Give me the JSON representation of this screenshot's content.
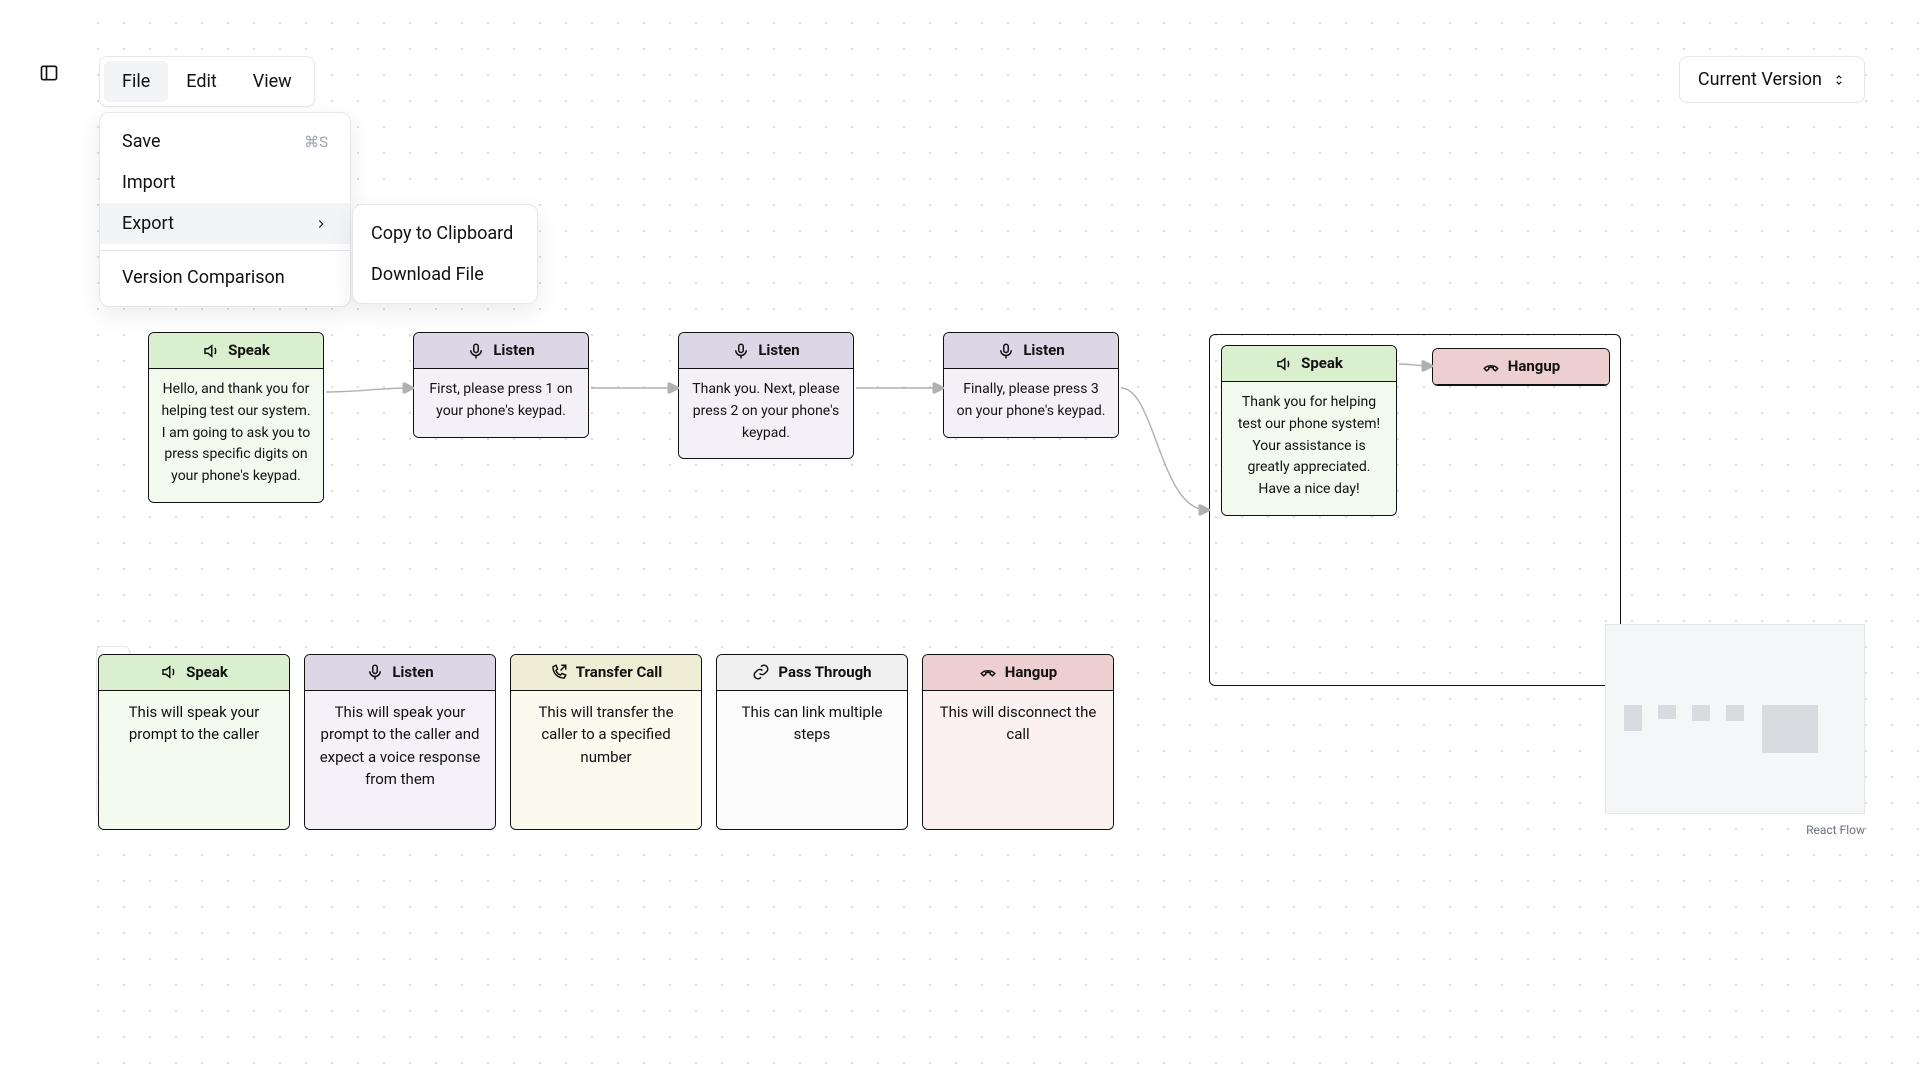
{
  "menubar": {
    "file": "File",
    "edit": "Edit",
    "view": "View"
  },
  "file_menu": {
    "save": "Save",
    "save_shortcut": "⌘S",
    "import": "Import",
    "export": "Export",
    "version_comparison": "Version Comparison"
  },
  "export_menu": {
    "copy": "Copy to Clipboard",
    "download": "Download File"
  },
  "version_selector": {
    "label": "Current Version"
  },
  "attribution": "React Flow",
  "nodes": {
    "speak1": {
      "title": "Speak",
      "text": "Hello, and thank you for helping test our system. I am going to ask you to press specific digits on your phone's keypad."
    },
    "listen1": {
      "title": "Listen",
      "text": "First, please press 1 on your phone's keypad."
    },
    "listen2": {
      "title": "Listen",
      "text": "Thank you. Next, please press 2 on your phone's keypad."
    },
    "listen3": {
      "title": "Listen",
      "text": "Finally, please press 3 on your phone's keypad."
    },
    "speak2": {
      "title": "Speak",
      "text": "Thank you for helping test our phone system! Your assistance is greatly appreciated. Have a nice day!"
    },
    "hangup": {
      "title": "Hangup"
    }
  },
  "palette": {
    "speak": {
      "title": "Speak",
      "desc": "This will speak your prompt to the caller"
    },
    "listen": {
      "title": "Listen",
      "desc": "This will speak your prompt to the caller and expect a voice response from them"
    },
    "transfer": {
      "title": "Transfer Call",
      "desc": "This will transfer the caller to a specified number"
    },
    "pass": {
      "title": "Pass Through",
      "desc": "This can link multiple steps"
    },
    "hangup": {
      "title": "Hangup",
      "desc": "This will disconnect the call"
    }
  },
  "icons": {
    "speaker": "speaker-icon",
    "mic": "mic-icon",
    "phone_arrow": "transfer-icon",
    "link": "link-icon",
    "phone_down": "hangup-icon"
  },
  "chart_data": {
    "type": "flow-diagram",
    "nodes": [
      {
        "id": "n1",
        "kind": "Speak",
        "text_ref": "nodes.speak1.text"
      },
      {
        "id": "n2",
        "kind": "Listen",
        "text_ref": "nodes.listen1.text"
      },
      {
        "id": "n3",
        "kind": "Listen",
        "text_ref": "nodes.listen2.text"
      },
      {
        "id": "n4",
        "kind": "Listen",
        "text_ref": "nodes.listen3.text"
      },
      {
        "id": "g1",
        "kind": "Group",
        "children": [
          "n5",
          "n6"
        ]
      },
      {
        "id": "n5",
        "kind": "Speak",
        "text_ref": "nodes.speak2.text"
      },
      {
        "id": "n6",
        "kind": "Hangup"
      }
    ],
    "edges": [
      [
        "n1",
        "n2"
      ],
      [
        "n2",
        "n3"
      ],
      [
        "n3",
        "n4"
      ],
      [
        "n4",
        "g1"
      ],
      [
        "n5",
        "n6"
      ]
    ]
  }
}
